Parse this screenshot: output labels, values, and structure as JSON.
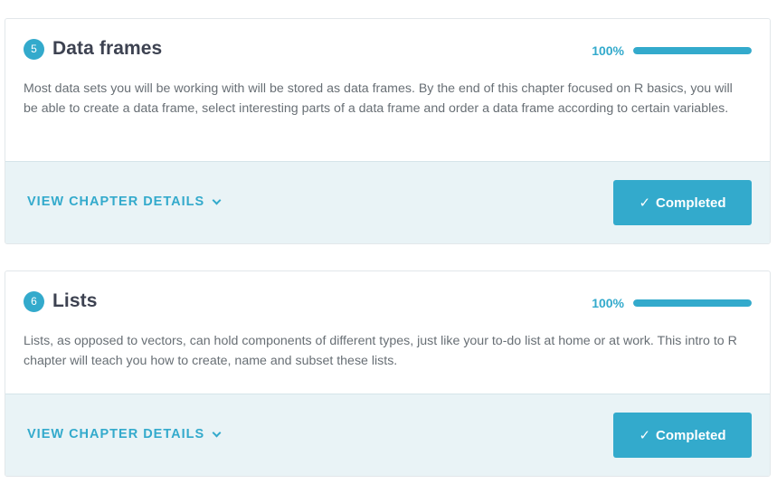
{
  "chapters": [
    {
      "number": "5",
      "title": "Data frames",
      "progress_label": "100%",
      "progress_value": 1.0,
      "description": "Most data sets you will be working with will be stored as data frames. By the end of this chapter focused on R basics, you will be able to create a data frame, select interesting parts of a data frame and order a data frame according to certain variables.",
      "details_label": "VIEW CHAPTER DETAILS",
      "status_label": "Completed"
    },
    {
      "number": "6",
      "title": "Lists",
      "progress_label": "100%",
      "progress_value": 1.0,
      "description": "Lists, as opposed to vectors, can hold components of different types, just like your to-do list at home or at work. This intro to R chapter will teach you how to create, name and subset these lists.",
      "details_label": "VIEW CHAPTER DETAILS",
      "status_label": "Completed"
    }
  ],
  "icons": {
    "check": "✓",
    "chevron": "chevron-down-icon"
  },
  "colors": {
    "accent": "#33aacc",
    "title": "#3d4251",
    "body_text": "#686f75",
    "footer_bg": "#e9f3f6"
  }
}
